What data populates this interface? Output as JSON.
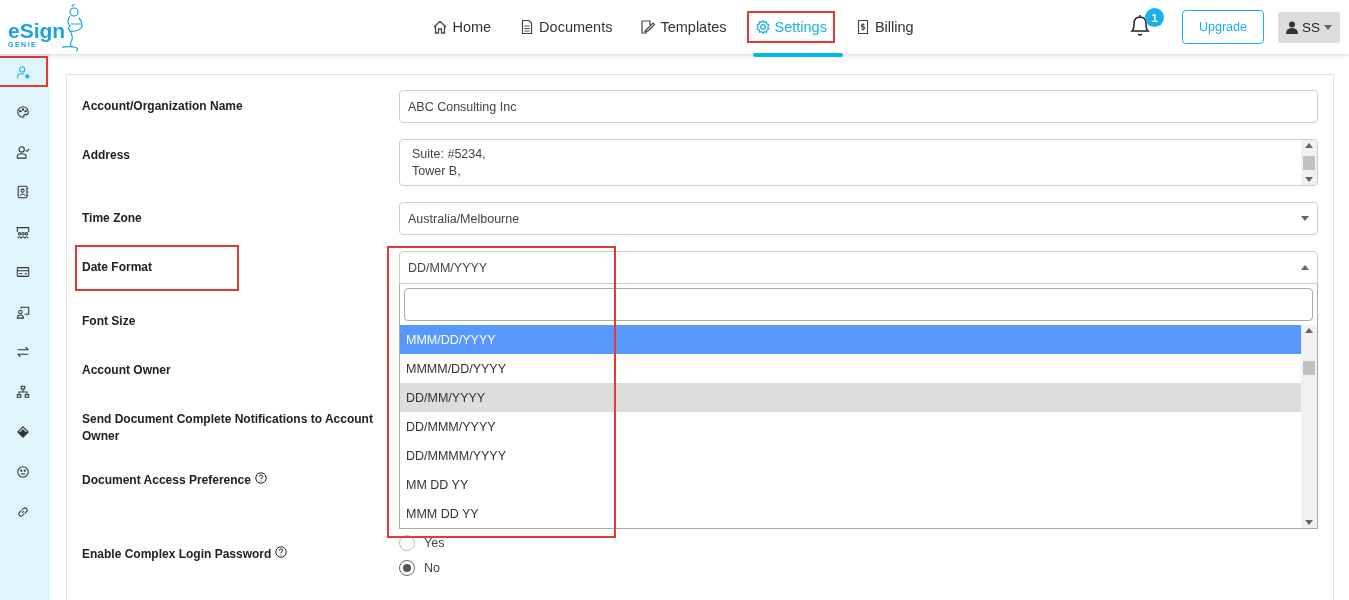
{
  "header": {
    "logo": {
      "word": "eSign",
      "sub": "GENIE"
    },
    "nav": [
      {
        "label": "Home",
        "selected": false,
        "highlighted": false
      },
      {
        "label": "Documents",
        "selected": false,
        "highlighted": false
      },
      {
        "label": "Templates",
        "selected": false,
        "highlighted": false
      },
      {
        "label": "Settings",
        "selected": true,
        "highlighted": true
      },
      {
        "label": "Billing",
        "selected": false,
        "highlighted": false
      }
    ],
    "notifications": {
      "count": "1"
    },
    "upgrade_button": "Upgrade",
    "user_menu": {
      "initials": "SS"
    }
  },
  "sidebar": {
    "items": [
      {
        "selected": true,
        "highlighted": true
      },
      {
        "selected": false,
        "highlighted": false
      },
      {
        "selected": false,
        "highlighted": false
      },
      {
        "selected": false,
        "highlighted": false
      },
      {
        "selected": false,
        "highlighted": false
      },
      {
        "selected": false,
        "highlighted": false
      },
      {
        "selected": false,
        "highlighted": false
      },
      {
        "selected": false,
        "highlighted": false
      },
      {
        "selected": false,
        "highlighted": false
      },
      {
        "selected": false,
        "highlighted": false
      },
      {
        "selected": false,
        "highlighted": false
      },
      {
        "selected": false,
        "highlighted": false
      }
    ]
  },
  "form": {
    "rows": [
      {
        "kind": "text",
        "label": "Account/Organization Name",
        "value": "ABC Consulting Inc",
        "help": false,
        "highlighted": false
      },
      {
        "kind": "textarea",
        "label": "Address",
        "lines": [
          "Suite: #5234,",
          "Tower B,"
        ],
        "help": false,
        "highlighted": false
      },
      {
        "kind": "select",
        "label": "Time Zone",
        "value": "Australia/Melbourne",
        "help": false,
        "highlighted": false
      },
      {
        "kind": "select_open",
        "label": "Date Format",
        "value": "DD/MM/YYYY",
        "help": false,
        "highlighted": true,
        "dropdown": {
          "highlighted": true,
          "options": [
            {
              "label": "MMM/DD/YYYY",
              "hovered": true,
              "selected": false
            },
            {
              "label": "MMMM/DD/YYYY",
              "hovered": false,
              "selected": false
            },
            {
              "label": "DD/MM/YYYY",
              "hovered": false,
              "selected": true
            },
            {
              "label": "DD/MMM/YYYY",
              "hovered": false,
              "selected": false
            },
            {
              "label": "DD/MMMM/YYYY",
              "hovered": false,
              "selected": false
            },
            {
              "label": "MM DD YY",
              "hovered": false,
              "selected": false
            },
            {
              "label": "MMM DD YY",
              "hovered": false,
              "selected": false
            }
          ]
        }
      },
      {
        "kind": "blank",
        "label": "Font Size",
        "help": false,
        "highlighted": false
      },
      {
        "kind": "blank",
        "label": "Account Owner",
        "help": false,
        "highlighted": false
      },
      {
        "kind": "blank",
        "label": "Send Document Complete Notifications to Account Owner",
        "help": false,
        "highlighted": false
      },
      {
        "kind": "blank",
        "label": "Document Access Preference",
        "help": true,
        "highlighted": false
      },
      {
        "kind": "radio",
        "label": "Enable Complex Login Password",
        "help": true,
        "highlighted": false,
        "options": [
          {
            "label": "Yes",
            "selected": false
          },
          {
            "label": "No",
            "selected": true
          }
        ]
      }
    ]
  }
}
